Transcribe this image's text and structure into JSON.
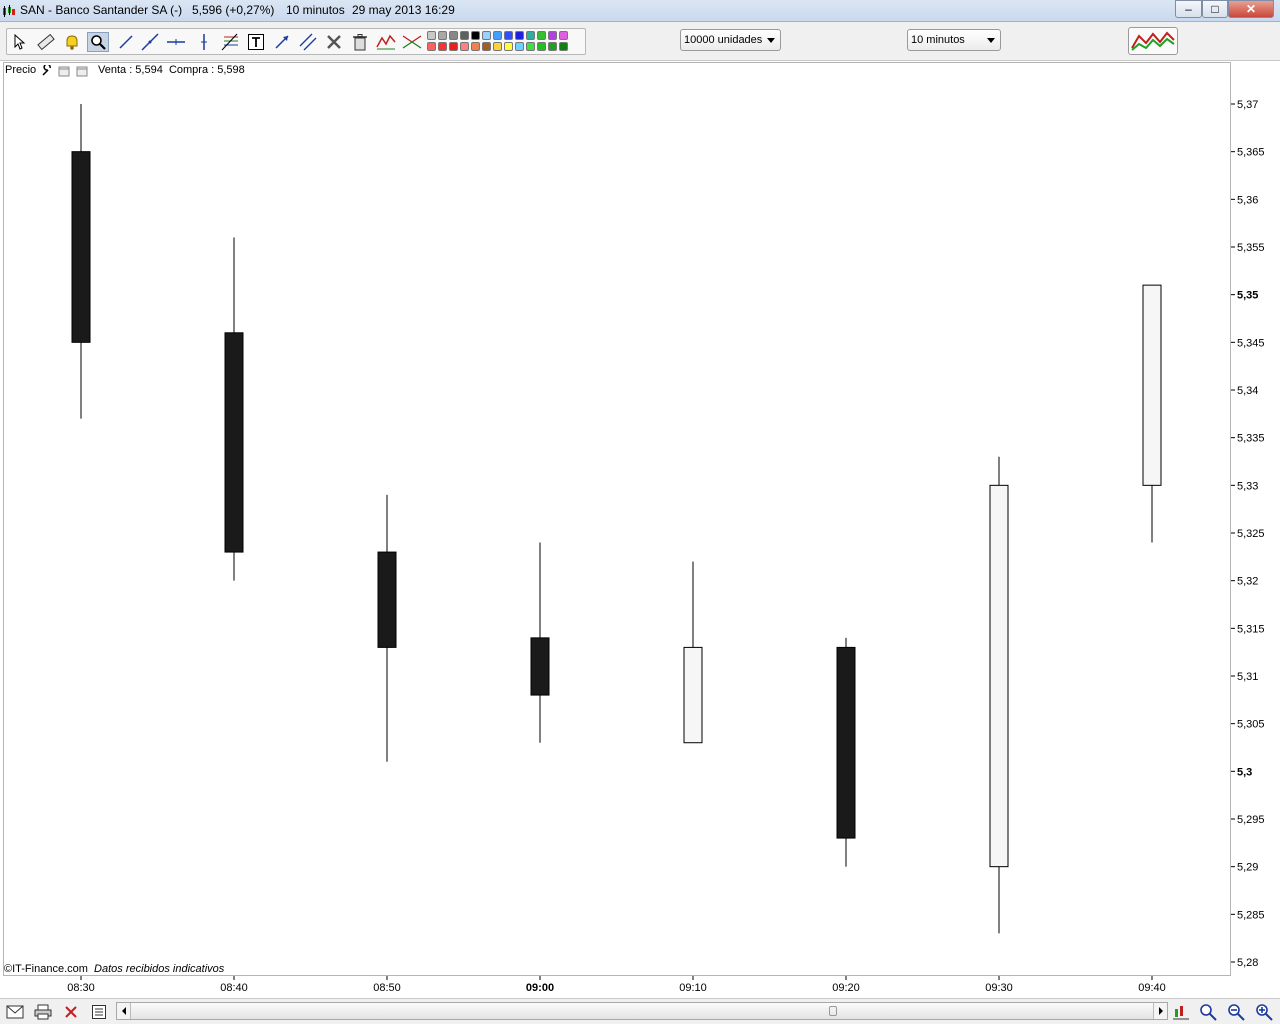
{
  "window": {
    "name": "SAN - Banco Santander SA (-)",
    "price": "5,596 (+0,27%)",
    "interval": "10 minutos",
    "datetime": "29 may 2013 16:29",
    "minimize": "–",
    "maximize": "□",
    "close": "✕"
  },
  "toolbar": {
    "tools": [
      "pointer-icon",
      "ruler-icon",
      "alert-bell-icon",
      "zoom-icon",
      "line-icon",
      "trend-line-icon",
      "horizontal-line-icon",
      "vertical-line-icon",
      "fibonacci-icon",
      "text-icon",
      "arrow-icon",
      "channel-icon",
      "tools-icon",
      "trash-icon",
      "wave-icon",
      "triangle-icon"
    ],
    "active_tool": "zoom-icon",
    "swatch_colors_top": [
      "#c8c8c8",
      "#a8a8a8",
      "#888888",
      "#606060",
      "#000000",
      "#9bd0ff",
      "#3fa0ff",
      "#3050ff",
      "#2020e0",
      "#2bb0a0",
      "#30c030",
      "#b040e0",
      "#e060e0"
    ],
    "swatch_colors_bottom": [
      "#ff6060",
      "#ff3030",
      "#e82020",
      "#ff8080",
      "#f08050",
      "#a06020",
      "#ffd040",
      "#ffff40",
      "#70d0ff",
      "#40e040",
      "#20c020",
      "#20a020",
      "#108010"
    ],
    "units": "10000 unidades",
    "interval": "10 minutos"
  },
  "legend": {
    "label": "Precio",
    "quote": "Venta : 5,594  Compra : 5,598"
  },
  "footer": {
    "credit": "©IT-Finance.com",
    "note": "Datos recibidos indicativos"
  },
  "colors": {
    "bear_candle": "#1a1a1a",
    "bull_candle": "#f6f6f6",
    "wick": "#000000"
  },
  "chart_data": {
    "type": "candlestick",
    "x": [
      "08:30",
      "08:40",
      "08:50",
      "09:00",
      "09:10",
      "09:20",
      "09:30",
      "09:40"
    ],
    "bold_x_labels": [
      "09:00"
    ],
    "candles": [
      {
        "time": "08:30",
        "open": 5.365,
        "high": 5.37,
        "low": 5.337,
        "close": 5.345
      },
      {
        "time": "08:40",
        "open": 5.346,
        "high": 5.356,
        "low": 5.32,
        "close": 5.323
      },
      {
        "time": "08:50",
        "open": 5.323,
        "high": 5.329,
        "low": 5.301,
        "close": 5.313
      },
      {
        "time": "09:00",
        "open": 5.314,
        "high": 5.324,
        "low": 5.303,
        "close": 5.308
      },
      {
        "time": "09:10",
        "open": 5.303,
        "high": 5.322,
        "low": 5.303,
        "close": 5.313
      },
      {
        "time": "09:20",
        "open": 5.313,
        "high": 5.314,
        "low": 5.29,
        "close": 5.293
      },
      {
        "time": "09:30",
        "open": 5.29,
        "high": 5.333,
        "low": 5.283,
        "close": 5.33
      },
      {
        "time": "09:40",
        "open": 5.33,
        "high": 5.351,
        "low": 5.324,
        "close": 5.351
      }
    ],
    "y_ticks": [
      "5,37",
      "5,365",
      "5,36",
      "5,355",
      "5,35",
      "5,345",
      "5,34",
      "5,335",
      "5,33",
      "5,325",
      "5,32",
      "5,315",
      "5,31",
      "5,305",
      "5,3",
      "5,295",
      "5,29",
      "5,285",
      "5,28"
    ],
    "bold_y_ticks": [
      "5,35",
      "5,3"
    ],
    "ylim": [
      5.28,
      5.37
    ],
    "grid": false,
    "axis_position": "right"
  }
}
